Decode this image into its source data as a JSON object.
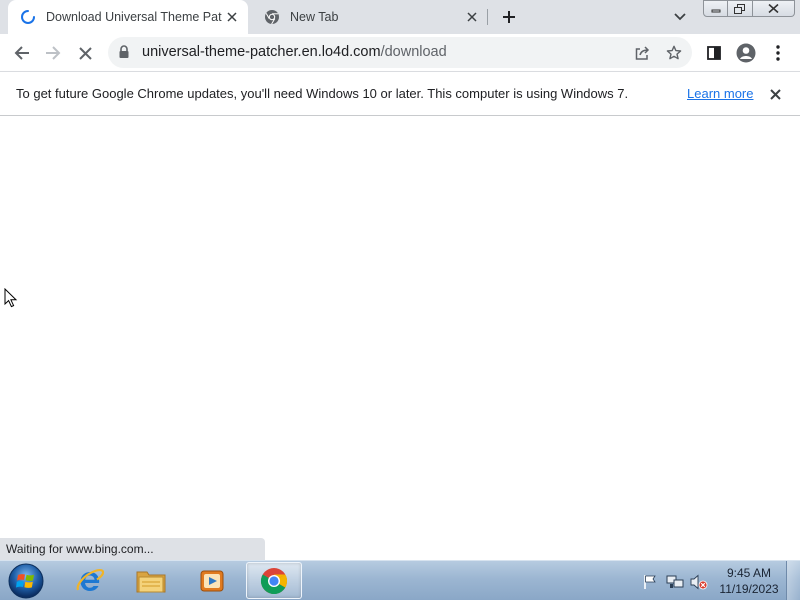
{
  "browser": {
    "tabs": [
      {
        "title": "Download Universal Theme Patcher",
        "state": "loading",
        "active": true
      },
      {
        "title": "New Tab",
        "state": "chrome-favicon",
        "active": false
      }
    ],
    "url": {
      "host": "universal-theme-patcher.en.lo4d.com",
      "path": "/download"
    },
    "infobar": {
      "message": "To get future Google Chrome updates, you'll need Windows 10 or later. This computer is using Windows 7.",
      "link_label": "Learn more"
    },
    "status_text": "Waiting for www.bing.com...",
    "colors": {
      "accent": "#1a73e8",
      "tabstrip": "#dee1e6",
      "omnibox": "#f1f3f4"
    }
  },
  "taskbar": {
    "pinned": [
      "internet-explorer-icon",
      "file-explorer-icon",
      "media-player-icon",
      "chrome-icon"
    ],
    "active_app": "chrome-icon",
    "tray": [
      "action-center-flag-icon",
      "network-icon",
      "volume-muted-icon"
    ],
    "clock": {
      "time": "9:45 AM",
      "date": "11/19/2023"
    }
  }
}
